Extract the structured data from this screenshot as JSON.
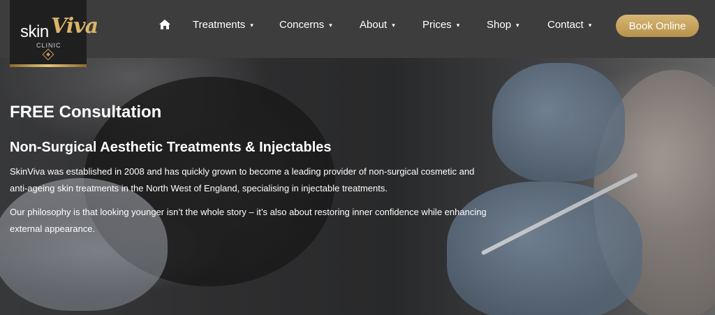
{
  "brand": {
    "logo_skin": "skin",
    "logo_viva": "Viva",
    "logo_clinic": "CLINIC",
    "accent_color": "#c9a35e"
  },
  "nav": {
    "home_icon": "home-icon",
    "items": [
      {
        "label": "Treatments"
      },
      {
        "label": "Concerns"
      },
      {
        "label": "About"
      },
      {
        "label": "Prices"
      },
      {
        "label": "Shop"
      },
      {
        "label": "Contact"
      }
    ],
    "caret": "▾",
    "book_label": "Book Online"
  },
  "hero": {
    "heading": "FREE Consultation",
    "subheading": "Non-Surgical Aesthetic Treatments & Injectables",
    "paragraph1": "SkinViva was established in 2008 and has quickly grown to become a leading provider of non-surgical cosmetic and anti-ageing skin treatments in the North West of England, specialising in injectable treatments.",
    "paragraph2": "Our philosophy is that looking younger isn’t the whole story – it’s also about restoring inner confidence while enhancing external appearance."
  }
}
